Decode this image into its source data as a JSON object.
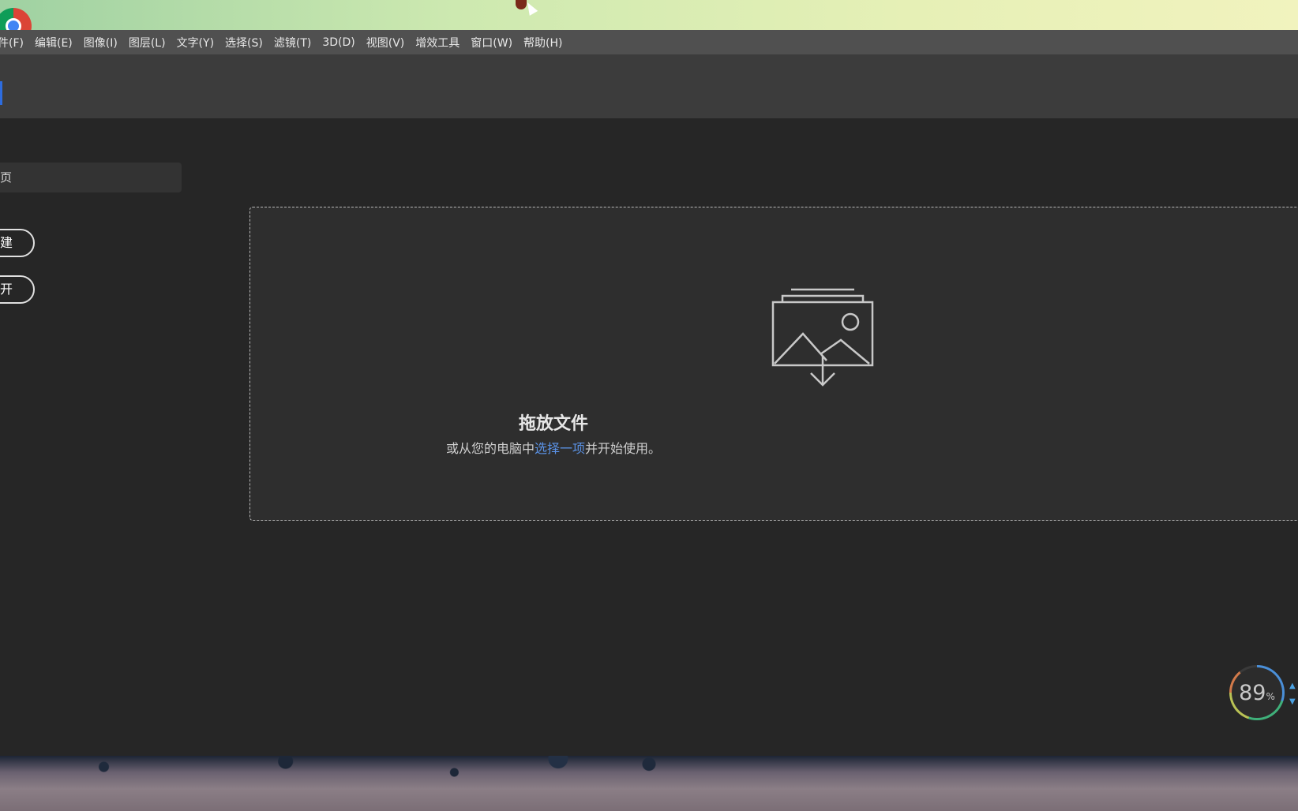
{
  "menubar": {
    "items": [
      {
        "label": "件(F)"
      },
      {
        "label": "编辑(E)"
      },
      {
        "label": "图像(I)"
      },
      {
        "label": "图层(L)"
      },
      {
        "label": "文字(Y)"
      },
      {
        "label": "选择(S)"
      },
      {
        "label": "滤镜(T)"
      },
      {
        "label": "3D(D)"
      },
      {
        "label": "视图(V)"
      },
      {
        "label": "增效工具"
      },
      {
        "label": "窗口(W)"
      },
      {
        "label": "帮助(H)"
      }
    ]
  },
  "home": {
    "tab_label": "页",
    "new_button_label": "建",
    "open_button_label": "开"
  },
  "drop_zone": {
    "title": "拖放文件",
    "subtitle_prefix": "或从您的电脑中",
    "subtitle_link": "选择一项",
    "subtitle_suffix": "并开始使用。",
    "link_color": "#5a92e6"
  },
  "system_monitor": {
    "cpu_value": "89",
    "cpu_unit": "%"
  },
  "icons": {
    "app_logo": "chrome-icon",
    "drop_icon": "image-download-icon",
    "mouse_cursor": "cursor-icon"
  }
}
